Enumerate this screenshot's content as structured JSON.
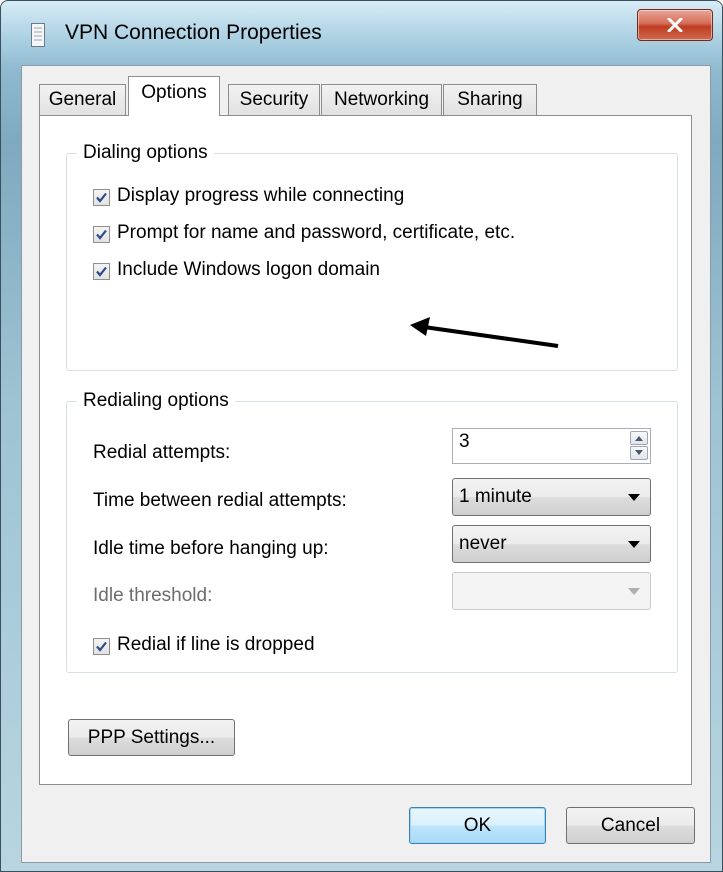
{
  "window": {
    "title": "VPN Connection Properties"
  },
  "tabs": [
    {
      "label": "General"
    },
    {
      "label": "Options"
    },
    {
      "label": "Security"
    },
    {
      "label": "Networking"
    },
    {
      "label": "Sharing"
    }
  ],
  "dialing": {
    "legend": "Dialing options",
    "options": [
      {
        "label": "Display progress while connecting",
        "checked": true
      },
      {
        "label": "Prompt for name and password, certificate, etc.",
        "checked": true
      },
      {
        "label": "Include Windows logon domain",
        "checked": true
      }
    ]
  },
  "redialing": {
    "legend": "Redialing options",
    "redial_attempts_label": "Redial attempts:",
    "redial_attempts_value": "3",
    "time_between_label": "Time between redial attempts:",
    "time_between_value": "1 minute",
    "idle_time_label": "Idle time before hanging up:",
    "idle_time_value": "never",
    "idle_threshold_label": "Idle threshold:",
    "idle_threshold_value": "",
    "redial_if_dropped_label": "Redial if line is dropped",
    "redial_if_dropped_checked": true
  },
  "buttons": {
    "ppp_settings": "PPP Settings...",
    "ok": "OK",
    "cancel": "Cancel"
  },
  "icons": {
    "window_icon": "document-icon",
    "close": "close-icon",
    "annotation": "arrow-icon"
  }
}
